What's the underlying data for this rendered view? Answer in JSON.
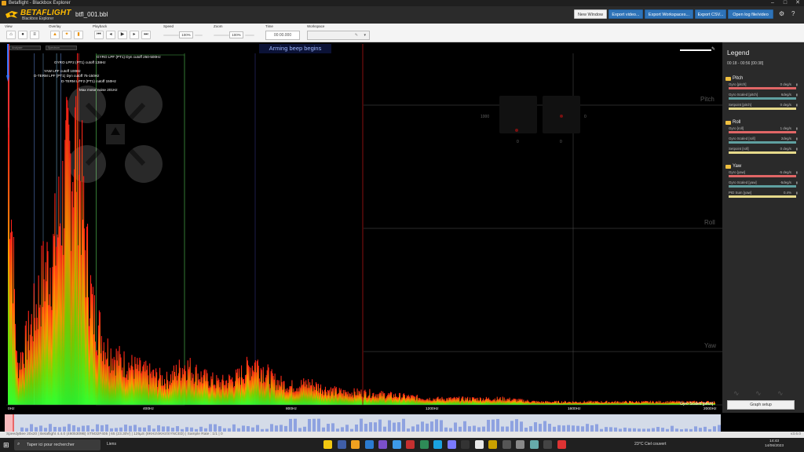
{
  "window": {
    "title": "Betaflight - Blackbox Explorer",
    "controls": [
      "–",
      "□",
      "✕"
    ]
  },
  "header": {
    "brand": "BETAFLIGHT",
    "subtitle": "Blackbox Explorer",
    "filename": "btfl_001.bbl",
    "buttons": {
      "new_window": "New Window",
      "export_video": "Export video...",
      "export_workspaces": "Export Workspaces...",
      "export_csv": "Export CSV...",
      "open_log": "Open log file/video"
    },
    "icons": {
      "settings": "gear-icon",
      "help": "help-icon"
    }
  },
  "toolbar": {
    "sections": {
      "view": "View",
      "overlay": "Overlay",
      "playback": "Playback",
      "speed": "Speed",
      "zoom": "Zoom",
      "time": "Time",
      "workspace": "Workspace"
    },
    "speed_value": "100%",
    "zoom_value": "100%",
    "time_value": "00:00.000",
    "workspace_value": ""
  },
  "graph": {
    "banner": "Arming beep begins",
    "x_ticks": [
      "0Hz",
      "400Hz",
      "800Hz",
      "1200Hz",
      "1600Hz",
      "2000Hz"
    ],
    "filter_labels": [
      "GYRO LPF (PT1) Dyn cutoff 250-500Hz",
      "GYRO LPF2 (PT1) cutoff 138Hz",
      "YAW LPF cutoff 100Hz",
      "D-TERM LPF (PT1) Dyn cutoff 75-150Hz",
      "D-TERM LPF2 (PT1) cutoff 150Hz",
      "Max motor noise 201Hz"
    ],
    "axis_names": [
      "Pitch",
      "Roll",
      "Yaw"
    ],
    "stick_values": {
      "throttle_max": "1000",
      "right_top": "0",
      "left_bottom": "0",
      "right_bottom": "0"
    },
    "field_label": "Gyro Scaled [pitch]",
    "top_dropdowns": [
      "Analyser",
      "Spectrum"
    ]
  },
  "chart_data": {
    "type": "area",
    "title": "",
    "xlabel": "Frequency",
    "ylabel": "",
    "xlim": [
      0,
      2000
    ],
    "x": [
      0,
      25,
      50,
      75,
      100,
      130,
      160,
      190,
      201,
      215,
      240,
      280,
      320,
      360,
      400,
      450,
      500,
      550,
      600,
      650,
      700,
      750,
      800,
      850,
      900,
      950,
      1000,
      1100,
      1200,
      1300,
      1400,
      1500,
      1600,
      1700,
      1800,
      1900,
      2000
    ],
    "series": [
      {
        "name": "Gyro Scaled [pitch]",
        "values": [
          0.92,
          0.12,
          0.2,
          0.3,
          0.42,
          0.5,
          0.72,
          0.86,
          0.85,
          0.55,
          0.3,
          0.18,
          0.14,
          0.12,
          0.1,
          0.08,
          0.13,
          0.09,
          0.07,
          0.09,
          0.14,
          0.08,
          0.06,
          0.07,
          0.05,
          0.04,
          0.04,
          0.03,
          0.02,
          0.02,
          0.02,
          0.01,
          0.01,
          0.01,
          0.01,
          0.01,
          0.01
        ]
      }
    ],
    "grid": false,
    "legend": "none"
  },
  "legend": {
    "title": "Legend",
    "range": "00:18 - 00:56 [00:38]",
    "groups": [
      {
        "name": "Pitch",
        "fields": [
          {
            "name": "Gyro [pitch]",
            "value": "0 deg/s",
            "color": "#e06666"
          },
          {
            "name": "Gyro Scaled [pitch]",
            "value": "6deg/s",
            "color": "#5fa0a0"
          },
          {
            "name": "Setpoint [pitch]",
            "value": "0 deg/s",
            "color": "#e6d98a"
          }
        ]
      },
      {
        "name": "Roll",
        "fields": [
          {
            "name": "Gyro [roll]",
            "value": "1 deg/s",
            "color": "#e06666"
          },
          {
            "name": "Gyro Scaled [roll]",
            "value": "2deg/s",
            "color": "#5fa0a0"
          },
          {
            "name": "Setpoint [roll]",
            "value": "0 deg/s",
            "color": "#e6d98a"
          }
        ]
      },
      {
        "name": "Yaw",
        "fields": [
          {
            "name": "Gyro [yaw]",
            "value": "-5 deg/s",
            "color": "#e06666"
          },
          {
            "name": "Gyro Scaled [yaw]",
            "value": "-5deg/s",
            "color": "#5fa0a0"
          },
          {
            "name": "PID Sum [yaw]",
            "value": "0.4%",
            "color": "#e6d98a"
          }
        ]
      }
    ],
    "graph_setup": "Graph setup"
  },
  "status": {
    "text": "SpeedyBee 20x20  |  Betaflight 4.4.0 (4605309B) STM32F405  |  65 (23.30V)  |  125µS (8KHz/4KHz/SYNCED)  |  Sample Rate : 1/1  |  0",
    "version": "v3.6.0"
  },
  "taskbar": {
    "search_placeholder": "Taper ici pour rechercher",
    "links": "Liens",
    "weather": "23°C  Ciel couvert",
    "time": "14:43",
    "date": "14/06/2023"
  }
}
